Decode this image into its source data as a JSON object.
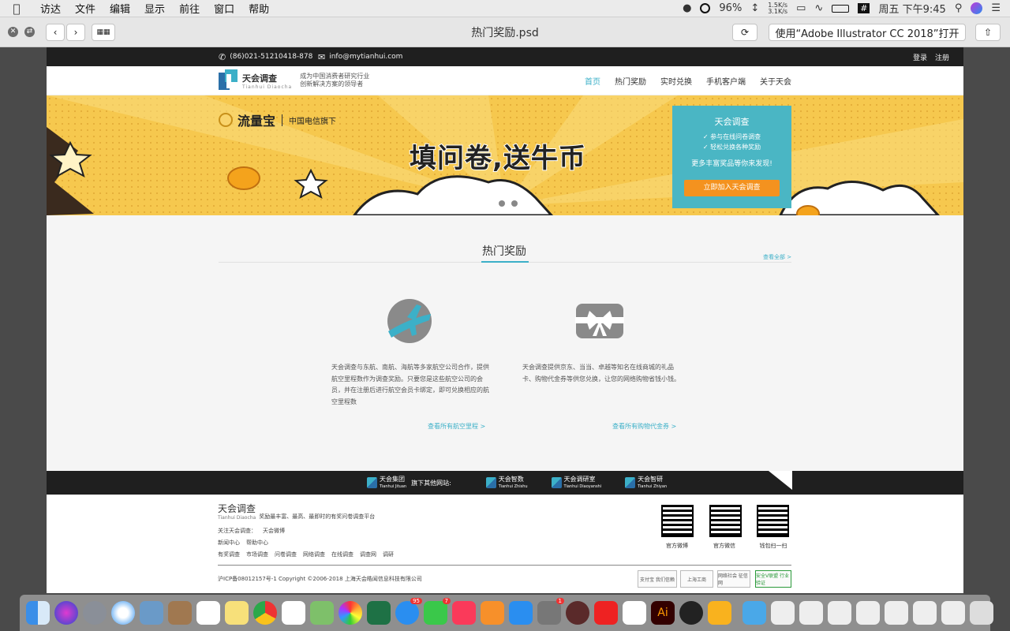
{
  "menubar": {
    "apple": "",
    "items": [
      "访达",
      "文件",
      "编辑",
      "显示",
      "前往",
      "窗口",
      "帮助"
    ],
    "battery": "96%",
    "net_up": "1.5K/s",
    "net_down": "3.1K/s",
    "clock": "周五 下午9:45"
  },
  "quicklook": {
    "title": "热门奖励.psd",
    "open_with": "使用“Adobe Illustrator CC 2018”打开"
  },
  "site": {
    "phone": "(86)021-51210418-878",
    "email": "info@mytianhui.com",
    "login": "登录",
    "register": "注册",
    "logo_cn": "天会调查",
    "logo_en": "Tianhui  Diaocha",
    "slogan_1": "成为中国消费者研究行业",
    "slogan_2": "创新解决方案的领导者",
    "nav": [
      "首页",
      "热门奖励",
      "实时兑换",
      "手机客户端",
      "关于天会"
    ],
    "hero": {
      "brand": "流量宝",
      "brand_sub": "中国电信旗下",
      "headline": "填问卷,送牛币",
      "promo_title": "天会调查",
      "promo_line1": "✓  参与在线问卷调查",
      "promo_line2": "✓  轻松兑换各种奖励",
      "promo_more": "更多丰富奖品等你来发现!",
      "promo_button": "立即加入天会调查"
    },
    "section": {
      "title": "热门奖励",
      "more": "查看全部 >",
      "cards": [
        {
          "desc": "天会调查与东航、南航、海航等多家航空公司合作，提供航空里程数作为调查奖励。只要您是这些航空公司的会员，并在注册后进行航空会员卡绑定，即可兑换相应的航空里程数",
          "link": "查看所有航空里程 >"
        },
        {
          "desc": "天会调查提供京东、当当、卓越等知名在线商城的礼品卡、购物代金券等供您兑换，让您的网络购物省钱小钱。",
          "link": "查看所有购物代金券 >"
        }
      ]
    },
    "footer_dark": {
      "group": "天会集团",
      "group_en": "Tianhui  Jituan",
      "label": "旗下其他网站:",
      "sites": [
        {
          "cn": "天会智数",
          "en": "Tianhui  Zhishu"
        },
        {
          "cn": "天会调研室",
          "en": "Tianhui  Diaoyanshi"
        },
        {
          "cn": "天会智研",
          "en": "Tianhui  Zhiyan"
        }
      ]
    },
    "footer": {
      "brand": "天会调查",
      "brand_en": "Tianhui  Diaocha",
      "tagline": "奖励最丰富、最高、最即时的有奖问卷调查平台",
      "follow": "关注天会调查：",
      "weibo": "天会微博",
      "row2": [
        "新闻中心",
        "帮助中心"
      ],
      "row3": [
        "有奖调查",
        "市场调查",
        "问卷调查",
        "网络调查",
        "在线调查",
        "调查网",
        "调研"
      ],
      "copyright": "沪ICP备08012157号-1  Copyright ©2006-2018 上海天会皓闻信息科技有限公司",
      "qr_labels": [
        "官方微博",
        "官方微信",
        "钱包扫一扫"
      ],
      "badges": [
        "支付宝 我们信赖",
        "上海工商",
        "网络社会 征信网",
        "安全V联盟 行业验证"
      ]
    }
  },
  "dock": {
    "badges": {
      "messages": "95",
      "facetime": "7",
      "prefs": "1"
    }
  },
  "colors": {
    "accent": "#3cb0c8",
    "hero_yellow": "#f6c84e",
    "promo_bg": "#4ab6c4",
    "promo_btn": "#f4921f",
    "dark_bar": "#1f1f1f"
  }
}
